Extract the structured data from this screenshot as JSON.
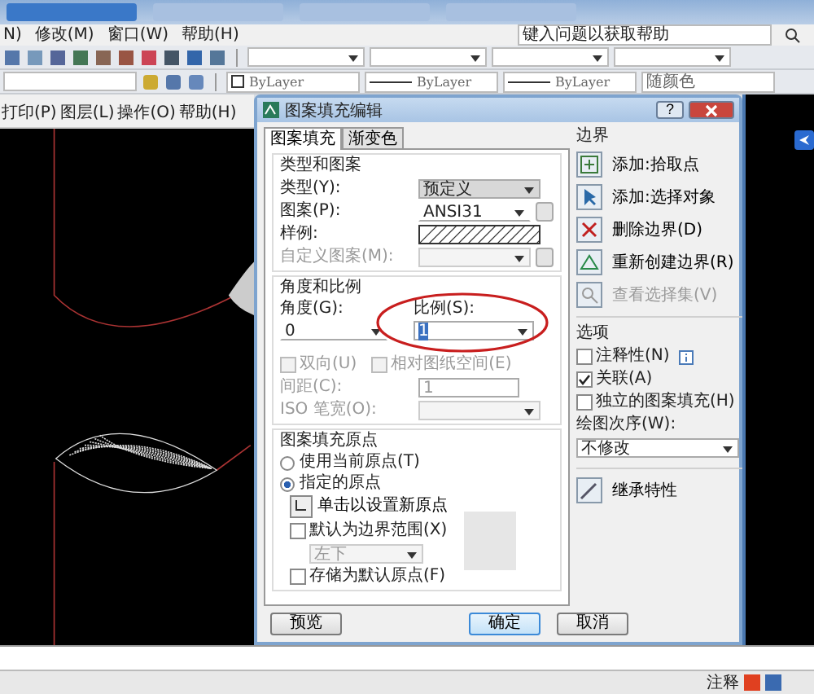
{
  "menubar": {
    "items": [
      "N)",
      "修改(M)",
      "窗口(W)",
      "帮助(H)"
    ],
    "help_search": "键入问题以获取帮助"
  },
  "properties": {
    "layer_color": "ByLayer",
    "linetype": "ByLayer",
    "lineweight": "ByLayer",
    "plotstyle": "随颜色"
  },
  "drawing_window": {
    "menu": [
      "打印(P)",
      "图层(L)",
      "操作(O)",
      "帮助(H)"
    ]
  },
  "dialog": {
    "title": "图案填充编辑",
    "help": "?",
    "tabs": [
      {
        "label": "图案填充",
        "selected": true
      },
      {
        "label": "渐变色",
        "selected": false
      }
    ],
    "type_and_pattern": {
      "title": "类型和图案",
      "type": {
        "label": "类型(Y):",
        "value": "预定义"
      },
      "pattern": {
        "label": "图案(P):",
        "value": "ANSI31"
      },
      "swatch": {
        "label": "样例:"
      },
      "custom": {
        "label": "自定义图案(M):",
        "disabled": true
      }
    },
    "angle_scale": {
      "title": "角度和比例",
      "angle": {
        "label": "角度(G):",
        "value": "0"
      },
      "scale": {
        "label": "比例(S):",
        "value": "1"
      },
      "checks": [
        {
          "label": "双向(U)",
          "checked": false,
          "disabled": true
        },
        {
          "label": "相对图纸空间(E)",
          "checked": false,
          "disabled": true
        }
      ],
      "spacing": {
        "label": "间距(C):",
        "value": "1",
        "disabled": true
      },
      "iso": {
        "label": "ISO 笔宽(O):",
        "disabled": true
      }
    },
    "origin": {
      "title": "图案填充原点",
      "radios": [
        {
          "label": "使用当前原点(T)",
          "selected": false
        },
        {
          "label": "指定的原点",
          "selected": true
        }
      ],
      "set_button": "单击以设置新原点",
      "default_extent": {
        "label": "默认为边界范围(X)",
        "checked": false
      },
      "position": {
        "value": "左下",
        "disabled": true
      },
      "store": {
        "label": "存储为默认原点(F)",
        "checked": false
      }
    },
    "boundary": {
      "title": "边界",
      "buttons": [
        {
          "label": "添加:拾取点",
          "kind": "pick",
          "disabled": false
        },
        {
          "label": "添加:选择对象",
          "kind": "select",
          "disabled": false
        },
        {
          "label": "删除边界(D)",
          "kind": "remove",
          "disabled": false
        },
        {
          "label": "重新创建边界(R)",
          "kind": "recreate",
          "disabled": false
        },
        {
          "label": "查看选择集(V)",
          "kind": "view",
          "disabled": true
        }
      ]
    },
    "options": {
      "title": "选项",
      "checks": [
        {
          "label": "注释性(N)",
          "checked": false,
          "kind": "annotative"
        },
        {
          "label": "关联(A)",
          "checked": true,
          "kind": "plain"
        },
        {
          "label": "独立的图案填充(H)",
          "checked": false,
          "kind": "plain"
        }
      ],
      "draw_order": {
        "label": "绘图次序(W):",
        "value": "不修改"
      }
    },
    "inherit": "继承特性",
    "buttons": [
      {
        "label": "预览",
        "default": false
      },
      {
        "label": "确定",
        "default": true
      },
      {
        "label": "取消",
        "default": false
      }
    ]
  },
  "status_bar": {
    "text": "注释"
  }
}
